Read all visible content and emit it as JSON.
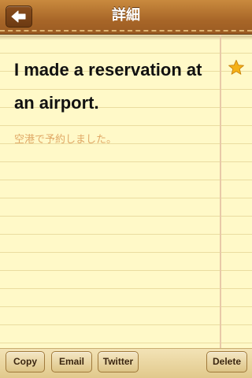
{
  "header": {
    "title": "詳細",
    "back_icon": "back-arrow-icon"
  },
  "note": {
    "english": "I made a reservation at an airport.",
    "japanese": "空港で予約しました。",
    "favorite_icon": "star-icon",
    "star_color": "#f5b117"
  },
  "toolbar": {
    "copy_label": "Copy",
    "email_label": "Email",
    "twitter_label": "Twitter",
    "delete_label": "Delete"
  }
}
